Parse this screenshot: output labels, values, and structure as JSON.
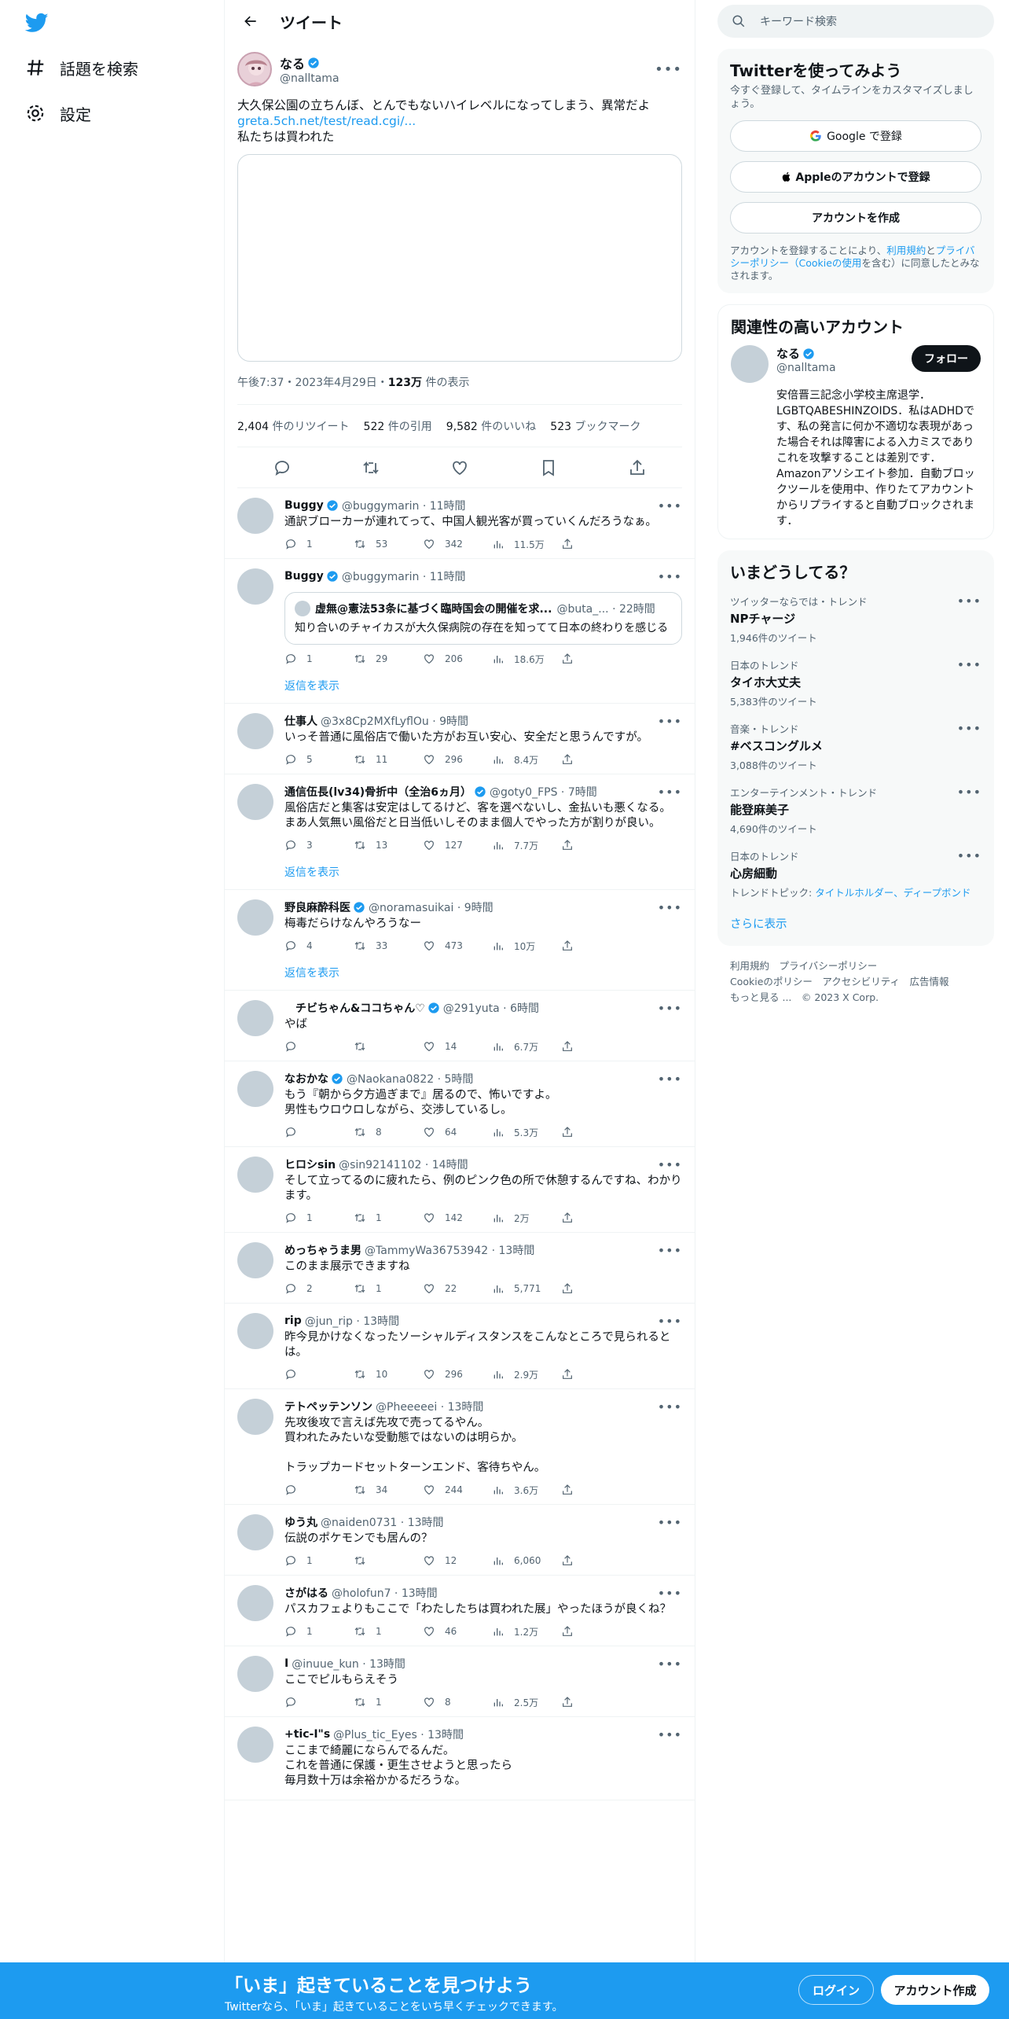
{
  "nav": {
    "explore": "話題を検索",
    "settings": "設定"
  },
  "header": {
    "title": "ツイート"
  },
  "tweet": {
    "name": "なる",
    "handle": "@nalltama",
    "text": "大久保公園の立ちんぼ、とんでもないハイレベルになってしまう、異常だよ",
    "link": "greta.5ch.net/test/read.cgi/...",
    "text2": "私たちは買われた",
    "time": "午後7:37・2023年4月29日・",
    "views_num": "123万",
    "views_label": " 件の表示",
    "retweets": "2,404",
    "retweets_label": " 件のリツイート",
    "quotes": "522",
    "quotes_label": " 件の引用",
    "likes": "9,582",
    "likes_label": " 件のいいね",
    "bookmarks": "523",
    "bookmarks_label": " ブックマーク"
  },
  "replies": [
    {
      "name": "Buggy",
      "verified": true,
      "handle": "@buggymarin · 11時間",
      "text": "通訳ブローカーが連れてって、中国人観光客が買っていくんだろうなぁ。",
      "reply": "1",
      "rt": "53",
      "like": "342",
      "views": "11.5万"
    },
    {
      "name": "Buggy",
      "verified": true,
      "handle": "@buggymarin · 11時間",
      "text": "",
      "quote_name": "虚無@憲法53条に基づく臨時国会の開催を求...",
      "quote_handle": "@buta_... · 22時間",
      "quote_text": "知り合いのチャイカスが大久保病院の存在を知ってて日本の終わりを感じる",
      "reply": "1",
      "rt": "29",
      "like": "206",
      "views": "18.6万",
      "show": "返信を表示"
    },
    {
      "name": "仕事人",
      "verified": false,
      "handle": "@3x8Cp2MXfLyflOu · 9時間",
      "text": "いっそ普通に風俗店で働いた方がお互い安心、安全だと思うんですが。",
      "reply": "5",
      "rt": "11",
      "like": "296",
      "views": "8.4万"
    },
    {
      "name": "通信伍長(lv34)骨折中（全治6ヵ月）",
      "verified": true,
      "handle": "@goty0_FPS · 7時間",
      "text": "風俗店だと集客は安定はしてるけど、客を選べないし、金払いも悪くなる。\nまあ人気無い風俗だと日当低いしそのまま個人でやった方が割りが良い。",
      "reply": "3",
      "rt": "13",
      "like": "127",
      "views": "7.7万",
      "show": "返信を表示"
    },
    {
      "name": "野良麻酔科医",
      "verified": true,
      "handle": "@noramasuikai · 9時間",
      "text": "梅毒だらけなんやろうなー",
      "reply": "4",
      "rt": "33",
      "like": "473",
      "views": "10万",
      "show": "返信を表示"
    },
    {
      "name": "　チビちゃん&ココちゃん♡",
      "verified": true,
      "handle": "@291yuta · 6時間",
      "text": "やば",
      "reply": "",
      "rt": "",
      "like": "14",
      "views": "6.7万"
    },
    {
      "name": "なおかな",
      "verified": true,
      "handle": "@Naokana0822 · 5時間",
      "text": "もう『朝から夕方過ぎまで』居るので、怖いですよ。\n男性もウロウロしながら、交渉しているし。",
      "reply": "",
      "rt": "8",
      "like": "64",
      "views": "5.3万"
    },
    {
      "name": "ヒロシsin",
      "verified": false,
      "handle": "@sin92141102 · 14時間",
      "text": "そして立ってるのに疲れたら、例のピンク色の所で休憩するんですね、わかります。",
      "reply": "1",
      "rt": "1",
      "like": "142",
      "views": "2万"
    },
    {
      "name": "めっちゃうま男",
      "verified": false,
      "handle": "@TammyWa36753942 · 13時間",
      "text": "このまま展示できますね",
      "reply": "2",
      "rt": "1",
      "like": "22",
      "views": "5,771"
    },
    {
      "name": "rip",
      "verified": false,
      "handle": "@jun_rip · 13時間",
      "text": "昨今見かけなくなったソーシャルディスタンスをこんなところで見られるとは。",
      "reply": "",
      "rt": "10",
      "like": "296",
      "views": "2.9万"
    },
    {
      "name": "テトペッテンソン",
      "verified": false,
      "handle": "@Pheeeeei · 13時間",
      "text": "先攻後攻で言えば先攻で売ってるやん。\n買われたみたいな受動態ではないのは明らか。\n\nトラップカードセットターンエンド、客待ちやん。",
      "reply": "",
      "rt": "34",
      "like": "244",
      "views": "3.6万"
    },
    {
      "name": "ゆう丸",
      "verified": false,
      "handle": "@naiden0731 · 13時間",
      "text": "伝説のポケモンでも居んの？",
      "reply": "1",
      "rt": "",
      "like": "12",
      "views": "6,060"
    },
    {
      "name": "さがはる",
      "verified": false,
      "handle": "@holofun7 · 13時間",
      "text": "パスカフェよりもここで「わたしたちは買われた展」やったほうが良くね？",
      "reply": "1",
      "rt": "1",
      "like": "46",
      "views": "1.2万"
    },
    {
      "name": "I",
      "verified": false,
      "handle": "@inuue_kun · 13時間",
      "text": "ここでピルもらえそう",
      "reply": "",
      "rt": "1",
      "like": "8",
      "views": "2.5万"
    },
    {
      "name": "+tic-I\"s",
      "verified": false,
      "handle": "@Plus_tic_Eyes · 13時間",
      "text": "ここまで綺麗にならんでるんだ。\nこれを普通に保護・更生させようと思ったら\n毎月数十万は余裕かかるだろうな。",
      "reply": "",
      "rt": "",
      "like": "",
      "views": "",
      "nofooter": true
    }
  ],
  "search": {
    "placeholder": "キーワード検索"
  },
  "signup": {
    "title": "Twitterを使ってみよう",
    "sub": "今すぐ登録して、タイムラインをカスタマイズしましょう。",
    "google": "Google で登録",
    "apple": "Appleのアカウントで登録",
    "create": "アカウントを作成",
    "legal_a": "アカウントを登録することにより、",
    "legal_terms": "利用規約",
    "legal_b": "と",
    "legal_privacy": "プライバシーポリシー（Cookieの使用",
    "legal_c": "を含む）に同意したとみなされます。"
  },
  "related": {
    "title": "関連性の高いアカウント",
    "name": "なる",
    "handle": "@nalltama",
    "follow": "フォロー",
    "bio": "安倍晋三記念小学校主席退学．LGBTQABESHINZOIDS．私はADHDです、私の発言に何か不適切な表現があった場合それは障害による入力ミスでありこれを攻撃することは差別です．Amazonアソシエイト参加．自動ブロックツールを使用中、作りたてアカウントからリプライすると自動ブロックされます．"
  },
  "trends": {
    "title": "いまどうしてる？",
    "items": [
      {
        "ctx": "ツイッターならでは・トレンド",
        "title": "NPチャージ",
        "count": "1,946件のツイート"
      },
      {
        "ctx": "日本のトレンド",
        "title": "タイホ大丈夫",
        "count": "5,383件のツイート"
      },
      {
        "ctx": "音楽・トレンド",
        "title": "#ベスコングルメ",
        "count": "3,088件のツイート"
      },
      {
        "ctx": "エンターテインメント・トレンド",
        "title": "能登麻美子",
        "count": "4,690件のツイート"
      },
      {
        "ctx": "日本のトレンド",
        "title": "心房細動",
        "count": "トレンドトピック: ",
        "links": "タイトルホルダー、ディープボンド"
      }
    ],
    "more": "さらに表示"
  },
  "footer": {
    "line1": "利用規約　プライバシーポリシー",
    "line2": "Cookieのポリシー　アクセシビリティ　広告情報",
    "line3": "もっと見る ...　© 2023 X Corp."
  },
  "bottom": {
    "title": "「いま」起きていることを見つけよう",
    "sub": "Twitterなら、「いま」起きていることをいち早くチェックできます。",
    "login": "ログイン",
    "signup": "アカウント作成"
  }
}
